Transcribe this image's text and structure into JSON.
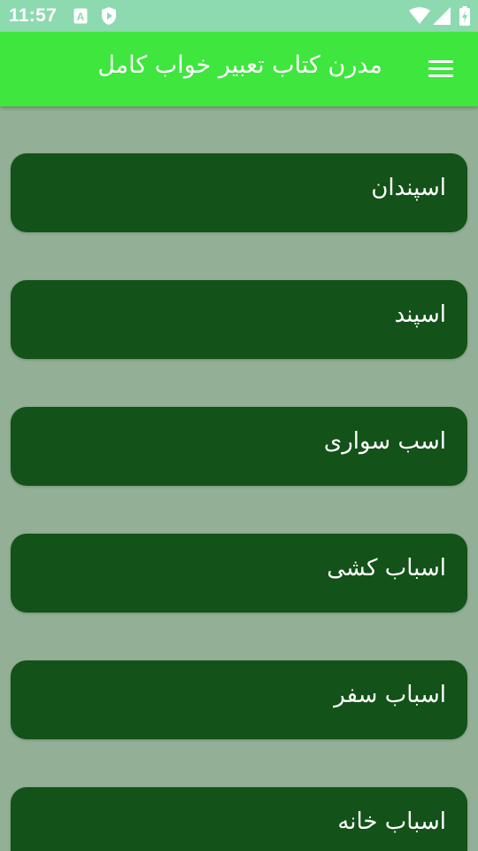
{
  "status_bar": {
    "time": "11:57",
    "left_icons": [
      "font-a-icon",
      "play-shield-icon"
    ],
    "right_icons": [
      "wifi-icon",
      "signal-icon",
      "battery-charging-icon"
    ]
  },
  "app_bar": {
    "title": "مدرن کتاب تعبیر خواب کامل",
    "menu_icon": "hamburger-menu-icon",
    "color": "#3ee63e"
  },
  "colors": {
    "background": "#93b096",
    "card": "#135218",
    "status_bar": "#8ddab0"
  },
  "items": [
    {
      "label": "اسپندان"
    },
    {
      "label": "اسپند"
    },
    {
      "label": "اسب سواری"
    },
    {
      "label": "اسباب کشی"
    },
    {
      "label": "اسباب سفر"
    },
    {
      "label": "اسباب خانه"
    }
  ]
}
